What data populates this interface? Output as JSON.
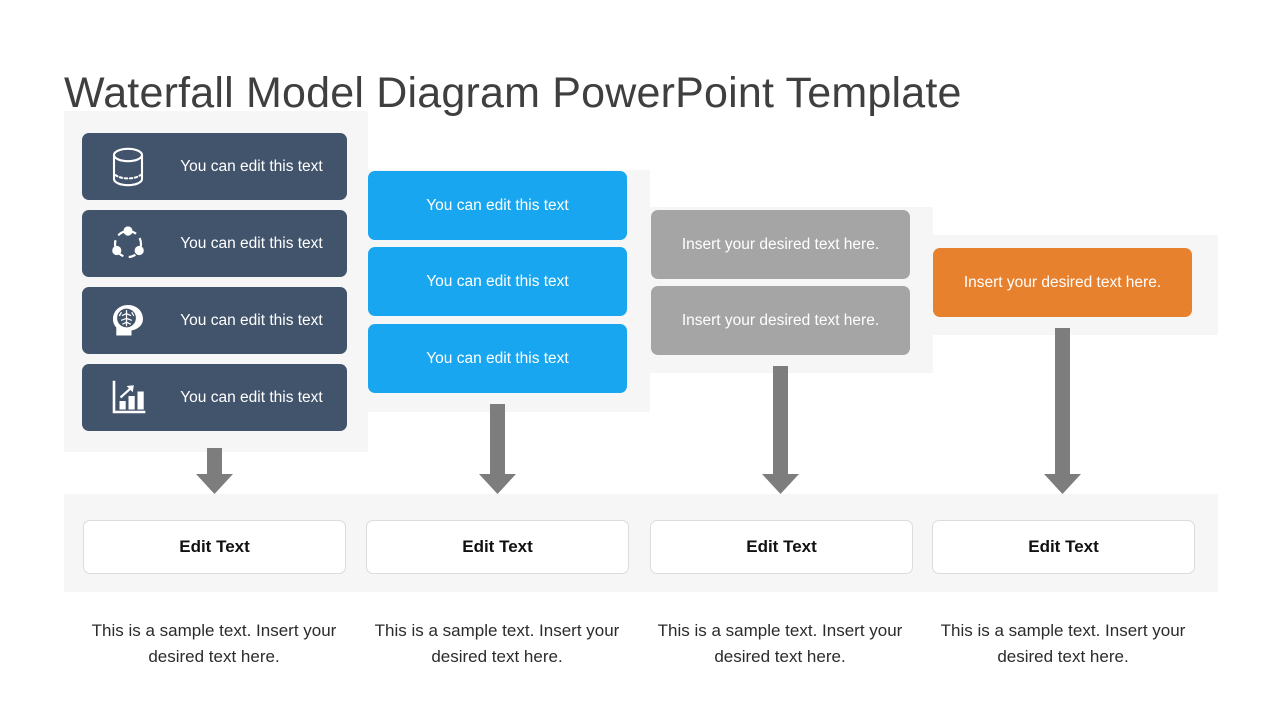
{
  "slide": {
    "title": "Waterfall Model Diagram PowerPoint Template"
  },
  "colors": {
    "dark_navy": "#42546b",
    "blue": "#17a6ef",
    "gray": "#a5a5a5",
    "orange": "#e8812e",
    "panel_bg": "#f6f6f6",
    "arrow": "#7d7d7d",
    "title_text": "#3f3f3f"
  },
  "columns": [
    {
      "id": "column-1",
      "style": "dark",
      "boxes": [
        {
          "icon": "database-icon",
          "label": "You can edit this text"
        },
        {
          "icon": "network-nodes-icon",
          "label": "You can edit this text"
        },
        {
          "icon": "brain-head-icon",
          "label": "You can edit this text"
        },
        {
          "icon": "bar-chart-growth-icon",
          "label": "You can edit this text"
        }
      ],
      "edit_card": "Edit Text",
      "caption": "This is a sample text. Insert your desired text here."
    },
    {
      "id": "column-2",
      "style": "blue",
      "boxes": [
        {
          "label": "You can edit this text"
        },
        {
          "label": "You can edit this text"
        },
        {
          "label": "You can edit this text"
        }
      ],
      "edit_card": "Edit Text",
      "caption": "This is a sample text. Insert your desired text here."
    },
    {
      "id": "column-3",
      "style": "gray",
      "boxes": [
        {
          "label": "Insert your desired text here."
        },
        {
          "label": "Insert your desired text here."
        }
      ],
      "edit_card": "Edit Text",
      "caption": "This is a sample text. Insert your desired text here."
    },
    {
      "id": "column-4",
      "style": "orange",
      "boxes": [
        {
          "label": "Insert your desired text here."
        }
      ],
      "edit_card": "Edit Text",
      "caption": "This is a sample text. Insert your desired text here."
    }
  ]
}
